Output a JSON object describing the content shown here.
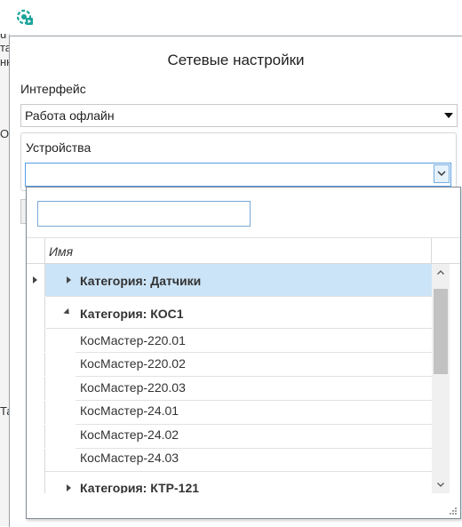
{
  "dialog": {
    "title": "Сетевые настройки",
    "interface_label": "Интерфейс",
    "interface_value": "Работа офлайн",
    "devices_label": "Устройства",
    "devices_value": ""
  },
  "behind_window": {
    "fragments": [
      "u",
      "та",
      "нн",
      "О",
      "Та"
    ]
  },
  "popup": {
    "search_value": "",
    "column_header": "Имя",
    "rows": [
      {
        "type": "category",
        "label": "Категория: Датчики",
        "expanded": false,
        "selected": true,
        "current": true
      },
      {
        "type": "category",
        "label": "Категория: КОС1",
        "expanded": true,
        "selected": false
      },
      {
        "type": "item",
        "label": "КосМастер-220.01"
      },
      {
        "type": "item",
        "label": "КосМастер-220.02"
      },
      {
        "type": "item",
        "label": "КосМастер-220.03"
      },
      {
        "type": "item",
        "label": "КосМастер-24.01"
      },
      {
        "type": "item",
        "label": "КосМастер-24.02"
      },
      {
        "type": "item",
        "label": "КосМастер-24.03"
      },
      {
        "type": "category",
        "label": "Категория: КТР-121",
        "expanded": false,
        "selected": false
      }
    ],
    "scroll_position": 0.08
  },
  "colors": {
    "selection": "#cce4f7",
    "accent_border": "#569de5",
    "icon_teal": "#1aa39a"
  },
  "icons": [
    "app-icon",
    "dropdown-arrow-icon",
    "chevron-down-icon",
    "expand-arrow-icon",
    "collapse-arrow-icon",
    "row-indicator-icon",
    "scroll-up-icon",
    "scroll-down-icon",
    "resize-grip-icon"
  ]
}
